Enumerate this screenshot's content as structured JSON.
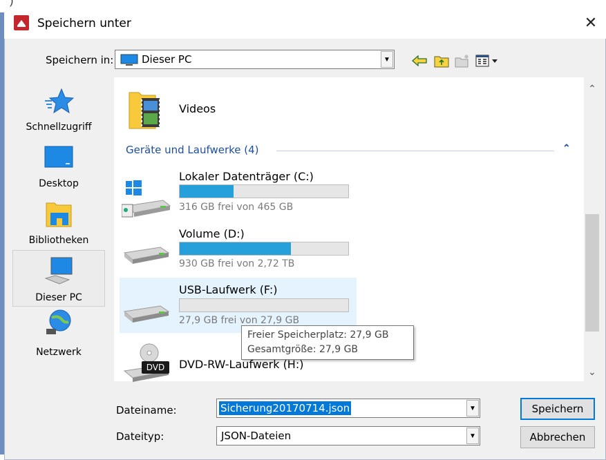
{
  "window": {
    "title": "Speichern unter"
  },
  "save_in": {
    "label": "Speichern in:",
    "value": "Dieser PC"
  },
  "places": [
    {
      "label": "Schnellzugriff"
    },
    {
      "label": "Desktop"
    },
    {
      "label": "Bibliotheken"
    },
    {
      "label": "Dieser PC"
    },
    {
      "label": "Netzwerk"
    }
  ],
  "folders": [
    {
      "name": "Videos"
    }
  ],
  "group": {
    "label": "Geräte und Laufwerke (4)"
  },
  "drives": [
    {
      "name": "Lokaler Datenträger (C:)",
      "free": "316 GB frei von 465 GB",
      "used_fraction": 0.32
    },
    {
      "name": "Volume (D:)",
      "free": "930 GB frei von 2,72 TB",
      "used_fraction": 0.66
    },
    {
      "name": "USB-Laufwerk (F:)",
      "free": "27,9 GB frei von 27,9 GB",
      "used_fraction": 0.0
    },
    {
      "name": "DVD-RW-Laufwerk (H:)",
      "badge": "DVD"
    }
  ],
  "tooltip": {
    "line1": "Freier Speicherplatz: 27,9 GB",
    "line2": "Gesamtgröße: 27,9 GB"
  },
  "filename": {
    "label": "Dateiname:",
    "value": "Sicherung20170714.json"
  },
  "filetype": {
    "label": "Dateityp:",
    "value": "JSON-Dateien"
  },
  "buttons": {
    "save": "Speichern",
    "cancel": "Abbrechen"
  },
  "colors": {
    "accent": "#26a0da",
    "group": "#1e4e9a",
    "highlight": "#e5f3ff"
  }
}
